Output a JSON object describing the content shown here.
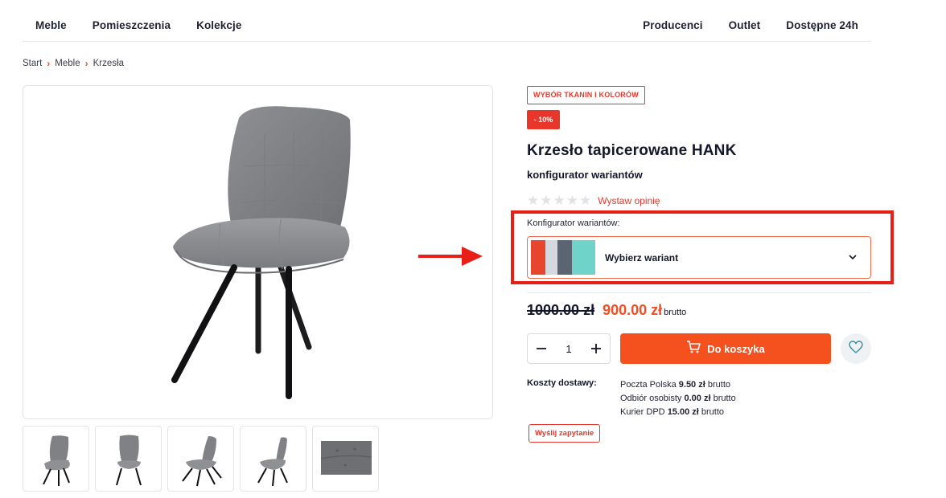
{
  "nav": {
    "left": [
      "Meble",
      "Pomieszczenia",
      "Kolekcje"
    ],
    "right": [
      "Producenci",
      "Outlet",
      "Dostępne 24h"
    ]
  },
  "breadcrumb": [
    "Start",
    "Meble",
    "Krzesła"
  ],
  "product": {
    "badge_fabrics": "WYBÓR TKANIN I KOLORÓW",
    "badge_discount": "- 10%",
    "title": "Krzesło tapicerowane HANK",
    "subtitle": "konfigurator wariantów",
    "rating_stars": 0,
    "rating_max": 5,
    "review_link": "Wystaw opinię",
    "config_label": "Konfigurator wariantów:",
    "variant_placeholder": "Wybierz wariant",
    "swatch_colors": [
      "#e8452f",
      "#d5d8de",
      "#5b6472",
      "#6fd3c9"
    ],
    "old_price": "1000.00 zł",
    "new_price": "900.00 zł",
    "price_suffix": "brutto",
    "quantity": "1",
    "add_to_cart": "Do koszyka",
    "shipping_label": "Koszty dostawy:",
    "shipping": [
      {
        "method": "Poczta Polska",
        "price": "9.50 zł",
        "suffix": "brutto"
      },
      {
        "method": "Odbiór osobisty",
        "price": "0.00 zł",
        "suffix": "brutto"
      },
      {
        "method": "Kurier DPD",
        "price": "15.00 zł",
        "suffix": "brutto"
      }
    ],
    "inquiry_button": "Wyślij zapytanie"
  },
  "colors": {
    "accent": "#f4511e",
    "badge_red": "#e8362b",
    "highlight": "#e81f17"
  }
}
